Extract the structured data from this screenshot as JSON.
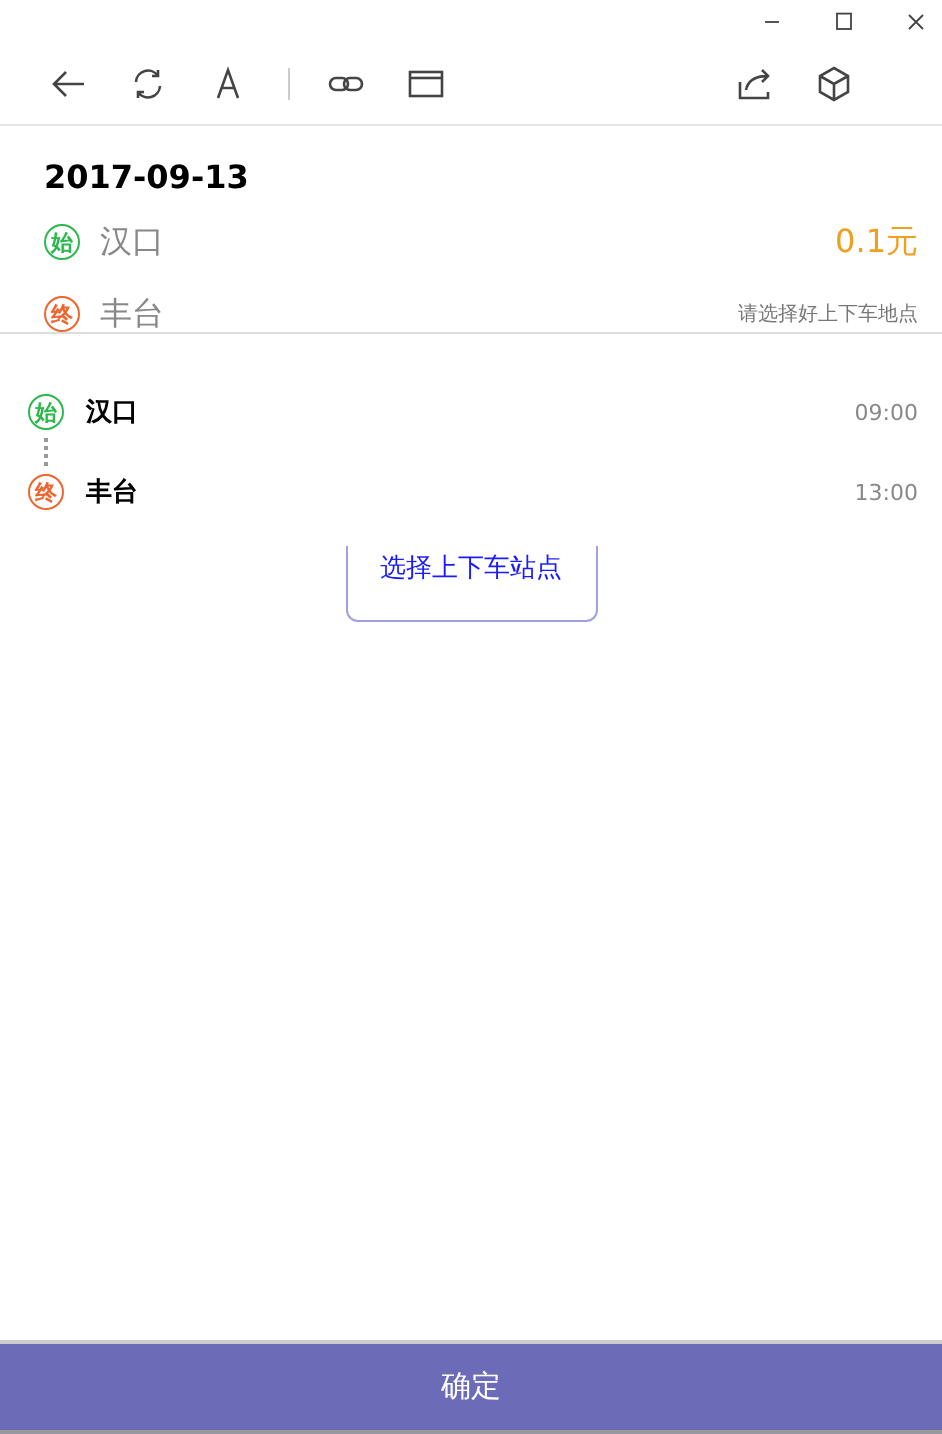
{
  "trip": {
    "date": "2017-09-13",
    "from": {
      "badge": "始",
      "color": "#2db84d",
      "name": "汉口"
    },
    "to": {
      "badge": "终",
      "color": "#f0642d",
      "name": "丰台"
    },
    "price": "0.1元",
    "hint": "请选择好上下车地点"
  },
  "stops": [
    {
      "badge": "始",
      "color": "#2db84d",
      "name": "汉口",
      "time": "09:00"
    },
    {
      "badge": "终",
      "color": "#f0642d",
      "name": "丰台",
      "time": "13:00"
    }
  ],
  "select_button": "选择上下车站点",
  "confirm_button": "确定"
}
